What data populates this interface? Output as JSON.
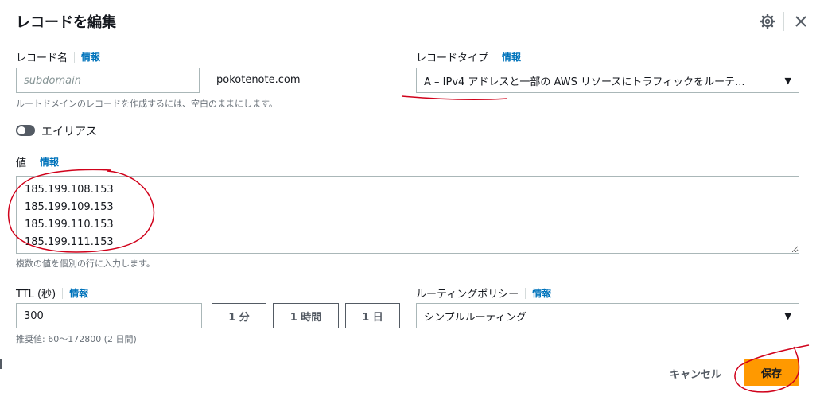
{
  "dialog": {
    "title": "レコードを編集",
    "settings_icon": "gear-icon",
    "close_icon": "close-icon"
  },
  "record_name": {
    "label": "レコード名",
    "info": "情報",
    "placeholder": "subdomain",
    "value": "",
    "domain_suffix": "pokotenote.com",
    "hint": "ルートドメインのレコードを作成するには、空白のままにします。"
  },
  "record_type": {
    "label": "レコードタイプ",
    "info": "情報",
    "selected": "A – IPv4 アドレスと一部の AWS リソースにトラフィックをルーテ..."
  },
  "alias": {
    "label": "エイリアス",
    "enabled": false
  },
  "value": {
    "label": "値",
    "info": "情報",
    "text": "185.199.108.153\n185.199.109.153\n185.199.110.153\n185.199.111.153",
    "hint": "複数の値を個別の行に入力します。"
  },
  "ttl": {
    "label": "TTL (秒)",
    "info": "情報",
    "value": "300",
    "buttons": [
      "1 分",
      "1 時間",
      "1 日"
    ],
    "hint": "推奨値: 60～172800 (2 日間)"
  },
  "routing_policy": {
    "label": "ルーティングポリシー",
    "info": "情報",
    "selected": "シンプルルーティング"
  },
  "footer": {
    "cancel": "キャンセル",
    "save": "保存"
  },
  "colors": {
    "primary": "#ff9900",
    "link": "#0073bb",
    "annotation": "#d0021b"
  }
}
